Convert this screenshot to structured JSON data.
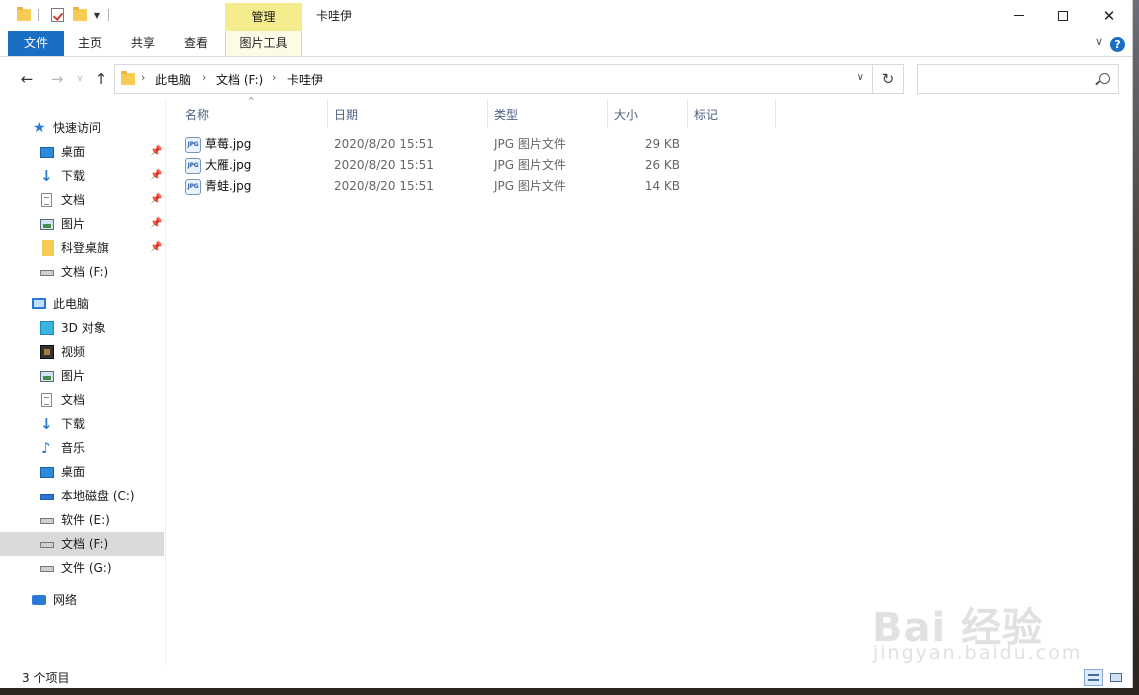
{
  "window": {
    "title": "卡哇伊",
    "contextual_tab_group": "管理",
    "controls": {
      "minimize": "—",
      "maximize": "☐",
      "close": "✕"
    }
  },
  "ribbon": {
    "tabs": [
      {
        "label": "文件",
        "active": true
      },
      {
        "label": "主页"
      },
      {
        "label": "共享"
      },
      {
        "label": "查看"
      },
      {
        "label": "图片工具",
        "contextual": true
      }
    ],
    "help": "?"
  },
  "address": {
    "crumbs": [
      "此电脑",
      "文档 (F:)",
      "卡哇伊"
    ],
    "search_placeholder": ""
  },
  "navpane": {
    "quick_access": {
      "label": "快速访问",
      "items": [
        {
          "label": "桌面",
          "icon": "desktop-icon",
          "pinned": true
        },
        {
          "label": "下载",
          "icon": "download-icon",
          "pinned": true
        },
        {
          "label": "文档",
          "icon": "document-icon",
          "pinned": true
        },
        {
          "label": "图片",
          "icon": "picture-icon",
          "pinned": true
        },
        {
          "label": "科登桌旗",
          "icon": "folder-icon",
          "pinned": true
        },
        {
          "label": "文档 (F:)",
          "icon": "drive-icon",
          "pinned": false
        }
      ]
    },
    "this_pc": {
      "label": "此电脑",
      "items": [
        {
          "label": "3D 对象",
          "icon": "3d-objects-icon"
        },
        {
          "label": "视频",
          "icon": "video-icon"
        },
        {
          "label": "图片",
          "icon": "picture-icon"
        },
        {
          "label": "文档",
          "icon": "document-icon"
        },
        {
          "label": "下载",
          "icon": "download-icon"
        },
        {
          "label": "音乐",
          "icon": "music-icon"
        },
        {
          "label": "桌面",
          "icon": "desktop-icon"
        },
        {
          "label": "本地磁盘 (C:)",
          "icon": "system-drive-icon"
        },
        {
          "label": "软件 (E:)",
          "icon": "drive-icon"
        },
        {
          "label": "文档 (F:)",
          "icon": "drive-icon",
          "selected": true
        },
        {
          "label": "文件 (G:)",
          "icon": "drive-icon"
        }
      ]
    },
    "network": {
      "label": "网络"
    }
  },
  "file_list": {
    "columns": [
      "名称",
      "日期",
      "类型",
      "大小",
      "标记"
    ],
    "sort_indicator": "^",
    "rows": [
      {
        "name": "草莓.jpg",
        "date": "2020/8/20 15:51",
        "type": "JPG 图片文件",
        "size": "29 KB",
        "icon_text": "JPG"
      },
      {
        "name": "大雁.jpg",
        "date": "2020/8/20 15:51",
        "type": "JPG 图片文件",
        "size": "26 KB",
        "icon_text": "JPG"
      },
      {
        "name": "青蛙.jpg",
        "date": "2020/8/20 15:51",
        "type": "JPG 图片文件",
        "size": "14 KB",
        "icon_text": "JPG"
      }
    ]
  },
  "status": {
    "count": "3 个项目"
  },
  "watermark": {
    "text": "Bai 经验",
    "sub": "jingyan.baidu.com"
  },
  "colors": {
    "accent": "#1a6fc4",
    "manage_tab": "#f5ec8e",
    "selected_row": "#d9d9d9"
  }
}
